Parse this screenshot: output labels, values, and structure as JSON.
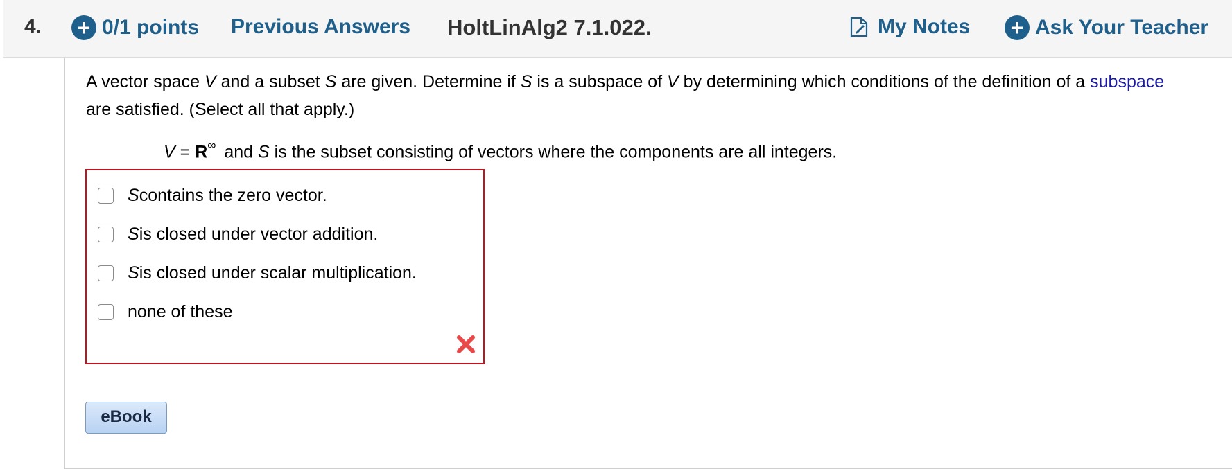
{
  "header": {
    "question_number": "4.",
    "points": "0/1 points",
    "previous_answers": "Previous Answers",
    "course_code": "HoltLinAlg2 7.1.022.",
    "my_notes": "My Notes",
    "ask_teacher": "Ask Your Teacher",
    "accent_color": "#1f5f8b"
  },
  "question": {
    "prompt_part1": "A vector space ",
    "var_V": "V",
    "prompt_part2": " and a subset ",
    "var_S": "S",
    "prompt_part3": " are given. Determine if ",
    "prompt_part4": " is a subspace of ",
    "prompt_part5": " by determining which conditions of the definition of a ",
    "link_text": "subspace",
    "prompt_part6": " are satisfied. (Select all that apply.)",
    "statement_V": "V",
    "statement_eq": " = ",
    "statement_R": "R",
    "statement_sup": "∞",
    "statement_and": "and ",
    "statement_S": "S",
    "statement_rest": " is the subset consisting of vectors where the components are all integers."
  },
  "options": [
    {
      "var": "S",
      "text": " contains the zero vector.",
      "checked": false
    },
    {
      "var": "S",
      "text": " is closed under vector addition.",
      "checked": false
    },
    {
      "var": "S",
      "text": " is closed under scalar multiplication.",
      "checked": false
    },
    {
      "var": "",
      "text": "none of these",
      "checked": false
    }
  ],
  "result": {
    "status_icon": "wrong-x-icon",
    "color": "#c0141e"
  },
  "ebook_label": "eBook"
}
